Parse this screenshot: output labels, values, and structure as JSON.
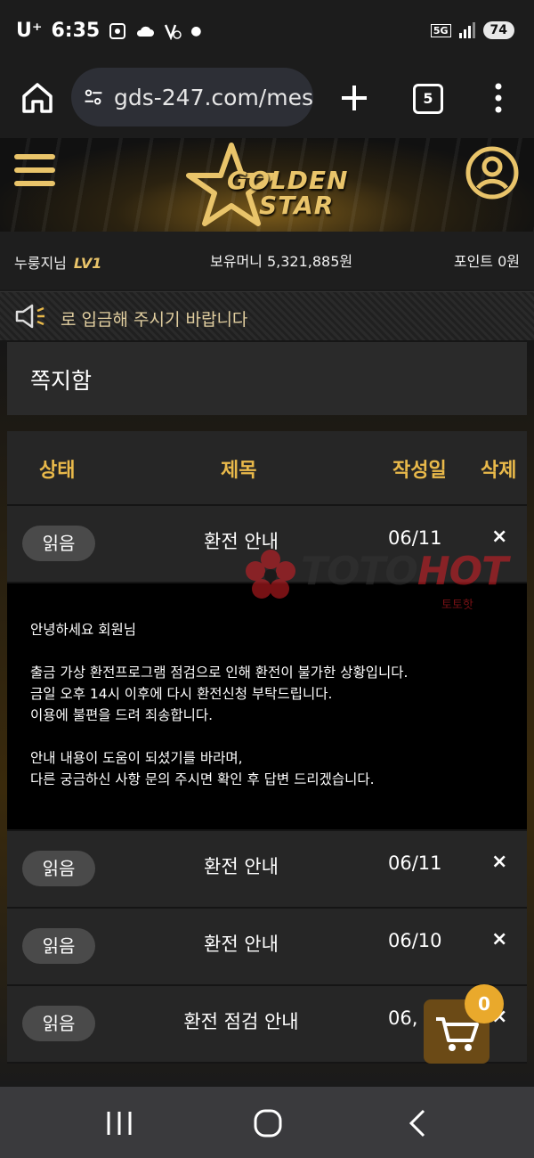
{
  "status_bar": {
    "carrier": "U⁺",
    "time": "6:35",
    "battery": "74",
    "network": "5G"
  },
  "browser": {
    "url": "gds-247.com/mes",
    "tab_count": "5"
  },
  "site": {
    "logo_line1": "GOLDEN",
    "logo_line2": "STAR"
  },
  "user_info": {
    "nickname": "누룽지님",
    "level": "LV1",
    "money": "보유머니 5,321,885원",
    "points": "포인트 0원"
  },
  "notice": {
    "text": "로 입금해 주시기 바랍니다"
  },
  "page": {
    "title": "쪽지함"
  },
  "table": {
    "headers": {
      "status": "상태",
      "subject": "제목",
      "date": "작성일",
      "delete": "삭제"
    },
    "rows": [
      {
        "status": "읽음",
        "subject": "환전 안내",
        "date": "06/11",
        "delete": "×"
      },
      {
        "status": "읽음",
        "subject": "환전 안내",
        "date": "06/11",
        "delete": "×"
      },
      {
        "status": "읽음",
        "subject": "환전 안내",
        "date": "06/10",
        "delete": "×"
      },
      {
        "status": "읽음",
        "subject": "환전 점검 안내",
        "date": "06,",
        "delete": "×"
      }
    ]
  },
  "message": {
    "greeting": "안녕하세요 회원님",
    "line1": "출금 가상 환전프로그램 점검으로 인해 환전이 불가한 상황입니다.",
    "line2": "금일 오후 14시 이후에 다시 환전신청 부탁드립니다.",
    "line3": "이용에 불편을 드려 죄송합니다.",
    "line4": "안내 내용이 도움이 되셨기를 바라며,",
    "line5": "다른 궁금하신 사항 문의 주시면 확인 후 답변 드리겠습니다."
  },
  "watermark": {
    "text_a": "TOTO",
    "text_b": "HOT",
    "sub": "토토핫"
  },
  "cart": {
    "count": "0"
  },
  "colors": {
    "gold": "#e9b94a",
    "cart_bg": "#6b4a16",
    "badge": "#e9a92c"
  }
}
